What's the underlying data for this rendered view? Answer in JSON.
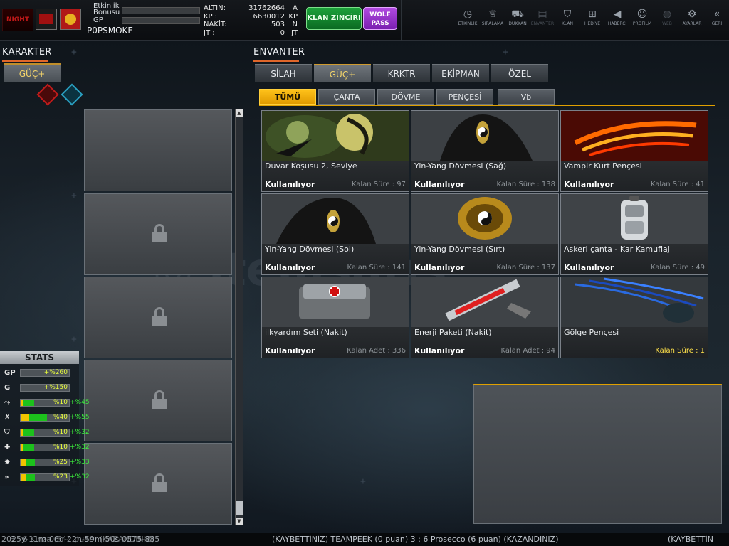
{
  "topbar": {
    "logo_text": "NIGHT",
    "etkinlik_label": "Etkinlik",
    "bonusu_label": "Bonusu",
    "gp_label": "GP",
    "player_name": "P0PSMOKE",
    "currency": [
      {
        "label": "ALTIN:",
        "value": "31762664",
        "unit": "A"
      },
      {
        "label": "KP :",
        "value": "6630012",
        "unit": "KP"
      },
      {
        "label": "NAKİT:",
        "value": "503",
        "unit": "N"
      },
      {
        "label": "JT :",
        "value": "0",
        "unit": "JT"
      }
    ],
    "klan_button": "KLAN ZİNCİRİ",
    "wolf_line1": "WOLF",
    "wolf_line2": "PASS",
    "nav": [
      {
        "label": "ETKİNLİK",
        "icon": "stopwatch-icon"
      },
      {
        "label": "SIRALAMA",
        "icon": "rank-medal-icon"
      },
      {
        "label": "DÜKKAN",
        "icon": "cart-icon"
      },
      {
        "label": "ENVANTER",
        "icon": "inventory-icon"
      },
      {
        "label": "KLAN",
        "icon": "shield-icon"
      },
      {
        "label": "HEDİYE",
        "icon": "gift-icon"
      },
      {
        "label": "HABERCİ",
        "icon": "megaphone-icon"
      },
      {
        "label": "PROFİLM",
        "icon": "profile-icon"
      },
      {
        "label": "WEB",
        "icon": "globe-icon"
      },
      {
        "label": "AYARLAR",
        "icon": "gear-icon"
      },
      {
        "label": "GERİ",
        "icon": "back-chevron-icon"
      }
    ]
  },
  "karakter": {
    "title": "KARAKTER",
    "tab_label": "GÜÇ+"
  },
  "stats": {
    "title": "STATS",
    "rows": [
      {
        "icon": "GP",
        "yellow": 0,
        "green": 0,
        "value": "+%260",
        "extra": ""
      },
      {
        "icon": "G",
        "yellow": 0,
        "green": 0,
        "value": "+%150",
        "extra": ""
      },
      {
        "icon": "run-icon",
        "yellow": 0.04,
        "green": 0.28,
        "value": "%10",
        "extra": "+%45"
      },
      {
        "icon": "jump-icon",
        "yellow": 0.18,
        "green": 0.55,
        "value": "%40",
        "extra": "+%55"
      },
      {
        "icon": "shield-stat-icon",
        "yellow": 0.04,
        "green": 0.28,
        "value": "%10",
        "extra": "+%32"
      },
      {
        "icon": "health-icon",
        "yellow": 0.04,
        "green": 0.28,
        "value": "%10",
        "extra": "+%32"
      },
      {
        "icon": "attack-icon",
        "yellow": 0.12,
        "green": 0.3,
        "value": "%25",
        "extra": "+%33"
      },
      {
        "icon": "speed-icon",
        "yellow": 0.12,
        "green": 0.3,
        "value": "%23",
        "extra": "+%32"
      }
    ]
  },
  "envanter": {
    "title": "ENVANTER",
    "tabs": [
      "SİLAH",
      "GÜÇ+",
      "KRKTR",
      "EKİPMAN",
      "ÖZEL"
    ],
    "subtabs": [
      "TÜMÜ",
      "ÇANTA",
      "DÖVME",
      "PENÇESİ",
      "Vb"
    ],
    "items": [
      {
        "name": "Duvar Koşusu 2, Seviye",
        "status": "Kullanılıyor",
        "remaining": "Kalan Süre : 97",
        "icon": "wolf-skill-icon"
      },
      {
        "name": "Yin-Yang Dövmesi (Sağ)",
        "status": "Kullanılıyor",
        "remaining": "Kalan Süre : 138",
        "icon": "yin-yang-tattoo-icon"
      },
      {
        "name": "Vampir Kurt Pençesi",
        "status": "Kullanılıyor",
        "remaining": "Kalan Süre : 41",
        "icon": "fire-claw-icon"
      },
      {
        "name": "Yin-Yang Dövmesi (Sol)",
        "status": "Kullanılıyor",
        "remaining": "Kalan Süre : 141",
        "icon": "yin-yang-tattoo-icon"
      },
      {
        "name": "Yin-Yang Dövmesi (Sırt)",
        "status": "Kullanılıyor",
        "remaining": "Kalan Süre : 137",
        "icon": "dragon-tattoo-icon"
      },
      {
        "name": "Askeri çanta - Kar Kamuflaj",
        "status": "Kullanılıyor",
        "remaining": "Kalan Süre : 49",
        "icon": "backpack-icon"
      },
      {
        "name": "ilkyardım Seti (Nakit)",
        "status": "Kullanılıyor",
        "remaining": "Kalan Adet : 336",
        "icon": "first-aid-kit-icon"
      },
      {
        "name": "Enerji Paketi (Nakit)",
        "status": "Kullanılıyor",
        "remaining": "Kalan Adet : 94",
        "icon": "syringe-icon"
      },
      {
        "name": "Gölge Pençesi",
        "status": "",
        "remaining": "Kalan Süre : 1",
        "icon": "shadow-claw-icon"
      }
    ]
  },
  "ticker": {
    "left": "2025y-11m-06d-22h-59m-50s-0575-885",
    "overlap": "3 : 6 Kinza (544 puan) (KAZANDINIZ)",
    "middle": "(KAYBETTİNİZ) TEAMPEEK (0 puan) 3 : 6 Prosecco (6 puan) (KAZANDINIZ)",
    "right": "(KAYBETTİN"
  },
  "colors": {
    "accent_orange": "#e0662a",
    "tab_active_gold": "#f3d56a",
    "subtab_active": "#ffc21a",
    "klan_green": "#1da13a",
    "wolf_purple": "#b04ae0",
    "stat_yellow": "#f2c400",
    "stat_green": "#1cc11c"
  }
}
